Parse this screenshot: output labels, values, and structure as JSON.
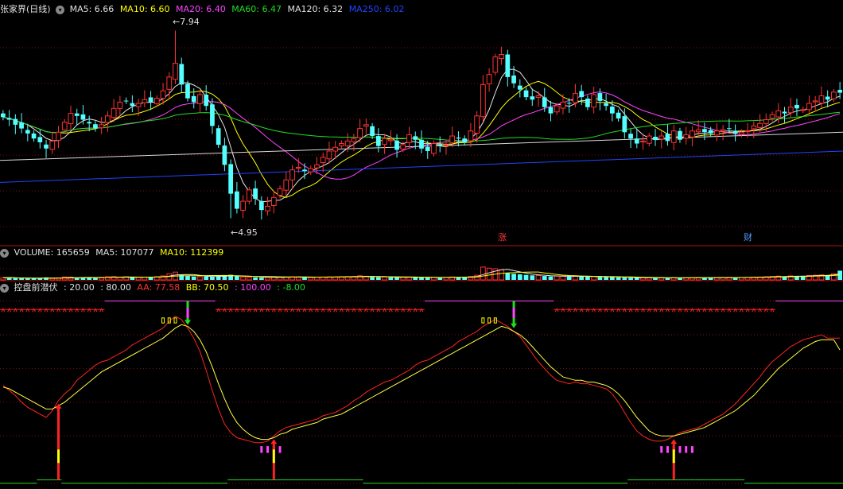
{
  "price_panel": {
    "stock_name": "张家界(日线)",
    "ma_labels": [
      {
        "text": "MA5: 6.66",
        "color": "#e0e0e0"
      },
      {
        "text": "MA10: 6.60",
        "color": "#ffff00"
      },
      {
        "text": "MA20: 6.40",
        "color": "#ff44ff"
      },
      {
        "text": "MA60: 6.47",
        "color": "#22dd22"
      },
      {
        "text": "MA120: 6.32",
        "color": "#e0e0e0"
      },
      {
        "text": "MA250: 6.02",
        "color": "#2244ff"
      }
    ],
    "high_label": "7.94",
    "low_label": "4.95",
    "marker_rise": "涨",
    "marker_fin": "财"
  },
  "volume_panel": {
    "labels": [
      {
        "text": "VOLUME: 165659",
        "color": "#e0e0e0"
      },
      {
        "text": "MA5: 107077",
        "color": "#e0e0e0"
      },
      {
        "text": "MA10: 112399",
        "color": "#ffff00"
      }
    ]
  },
  "indicator_panel": {
    "labels": [
      {
        "text": "控盘前潜伏",
        "color": "#e0e0e0"
      },
      {
        "text": ": 20.00",
        "color": "#e0e0e0"
      },
      {
        "text": ": 80.00",
        "color": "#e0e0e0"
      },
      {
        "text": "AA: 77.58",
        "color": "#ff3333"
      },
      {
        "text": "BB: 70.50",
        "color": "#ffff00"
      },
      {
        "text": ": 100.00",
        "color": "#ff44ff"
      },
      {
        "text": ": -8.00",
        "color": "#22dd22"
      }
    ]
  },
  "chart_data": [
    {
      "type": "candlestick",
      "title": "张家界(日线)",
      "ylim": [
        4.6,
        8.2
      ],
      "x_count": 137,
      "high_annotation": {
        "index": 28,
        "value": 7.94
      },
      "low_annotation": {
        "index": 37,
        "value": 4.95
      },
      "close_series": [
        6.56,
        6.52,
        6.44,
        6.38,
        6.3,
        6.22,
        6.16,
        6.06,
        6.18,
        6.32,
        6.48,
        6.62,
        6.58,
        6.52,
        6.46,
        6.38,
        6.44,
        6.58,
        6.7,
        6.8,
        6.82,
        6.74,
        6.78,
        6.84,
        6.8,
        6.86,
        6.98,
        7.2,
        7.42,
        7.08,
        6.86,
        6.8,
        6.92,
        6.74,
        6.42,
        6.12,
        5.8,
        5.34,
        5.1,
        5.22,
        5.4,
        5.26,
        5.08,
        5.14,
        5.28,
        5.42,
        5.56,
        5.72,
        5.76,
        5.7,
        5.74,
        5.8,
        5.92,
        6.02,
        6.08,
        6.14,
        6.18,
        6.22,
        6.38,
        6.44,
        6.26,
        6.1,
        6.22,
        6.2,
        6.04,
        6.12,
        6.28,
        6.2,
        6.06,
        6.02,
        6.14,
        6.1,
        6.12,
        6.26,
        6.22,
        6.16,
        6.34,
        6.58,
        7.08,
        7.24,
        7.52,
        7.56,
        7.2,
        7.1,
        7.0,
        6.88,
        6.84,
        6.9,
        6.72,
        6.62,
        6.74,
        6.8,
        6.78,
        6.94,
        6.88,
        6.72,
        6.92,
        6.82,
        6.74,
        6.62,
        6.54,
        6.32,
        6.22,
        6.14,
        6.18,
        6.26,
        6.2,
        6.26,
        6.18,
        6.34,
        6.2,
        6.28,
        6.34,
        6.36,
        6.32,
        6.3,
        6.34,
        6.36,
        6.38,
        6.3,
        6.32,
        6.34,
        6.42,
        6.46,
        6.52,
        6.6,
        6.66,
        6.62,
        6.72,
        6.7,
        6.68,
        6.78,
        6.82,
        6.9,
        6.84,
        6.96,
        6.95
      ],
      "moving_averages": [
        {
          "name": "MA5",
          "value": 6.66
        },
        {
          "name": "MA10",
          "value": 6.6
        },
        {
          "name": "MA20",
          "value": 6.4
        },
        {
          "name": "MA60",
          "value": 6.47
        },
        {
          "name": "MA120",
          "value": 6.32
        },
        {
          "name": "MA250",
          "value": 6.02
        }
      ]
    },
    {
      "type": "bar",
      "title": "VOLUME",
      "ylim": [
        0,
        400000
      ],
      "values": [
        40000,
        42000,
        30000,
        28000,
        26000,
        27000,
        30000,
        45000,
        26000,
        32000,
        52000,
        50000,
        42000,
        40000,
        38000,
        42000,
        48000,
        55000,
        60000,
        46000,
        54000,
        45000,
        48000,
        50000,
        56000,
        58000,
        72000,
        110000,
        140000,
        90000,
        70000,
        58000,
        56000,
        62000,
        64000,
        70000,
        76000,
        92000,
        70000,
        52000,
        48000,
        44000,
        40000,
        42000,
        46000,
        50000,
        52000,
        58000,
        55000,
        46000,
        44000,
        48000,
        52000,
        56000,
        54000,
        58000,
        60000,
        62000,
        74000,
        66000,
        52000,
        48000,
        50000,
        44000,
        42000,
        46000,
        50000,
        48000,
        42000,
        40000,
        44000,
        42000,
        46000,
        52000,
        48000,
        52000,
        62000,
        84000,
        230000,
        210000,
        200000,
        180000,
        130000,
        110000,
        100000,
        90000,
        82000,
        78000,
        70000,
        62000,
        68000,
        66000,
        60000,
        64000,
        62000,
        56000,
        60000,
        54000,
        52000,
        50000,
        46000,
        40000,
        38000,
        36000,
        36000,
        38000,
        36000,
        38000,
        34000,
        40000,
        36000,
        38000,
        40000,
        42000,
        40000,
        38000,
        40000,
        44000,
        46000,
        42000,
        44000,
        46000,
        50000,
        52000,
        58000,
        62000,
        68000,
        60000,
        72000,
        70000,
        68000,
        80000,
        84000,
        90000,
        86000,
        110000,
        165659
      ],
      "ma5": 107077,
      "ma10": 112399
    },
    {
      "type": "line",
      "title": "控盘前潜伏",
      "ylim": [
        -10,
        105
      ],
      "reference_levels": [
        20.0,
        80.0,
        100.0,
        -8.0
      ],
      "series": [
        {
          "name": "AA",
          "values": [
            50,
            47,
            44,
            40,
            37,
            35,
            33,
            31,
            35,
            41,
            45,
            48,
            53,
            56,
            59,
            62,
            64,
            65,
            67,
            69,
            71,
            74,
            76,
            78,
            80,
            82,
            84,
            88,
            91,
            89,
            84,
            78,
            70,
            59,
            47,
            36,
            27,
            22,
            19,
            18,
            17,
            16,
            16,
            17,
            20,
            23,
            25,
            26,
            27,
            28,
            29,
            30,
            32,
            33,
            34,
            36,
            38,
            41,
            43,
            46,
            48,
            50,
            52,
            53,
            55,
            57,
            59,
            62,
            64,
            65,
            67,
            69,
            71,
            73,
            76,
            78,
            80,
            82,
            85,
            87,
            89,
            87,
            85,
            82,
            79,
            74,
            69,
            64,
            60,
            56,
            53,
            52,
            51,
            52,
            51,
            51,
            50,
            49,
            48,
            45,
            40,
            34,
            28,
            23,
            20,
            18,
            17,
            17,
            18,
            20,
            22,
            23,
            24,
            25,
            27,
            29,
            31,
            33,
            36,
            39,
            43,
            47,
            51,
            55,
            60,
            64,
            67,
            70,
            73,
            75,
            77,
            78,
            79,
            80,
            78,
            78,
            78
          ]
        },
        {
          "name": "BB",
          "values": [
            49,
            48,
            46,
            44,
            42,
            40,
            38,
            36,
            36,
            38,
            40,
            43,
            46,
            49,
            52,
            55,
            58,
            60,
            62,
            64,
            66,
            68,
            70,
            72,
            74,
            76,
            78,
            81,
            84,
            86,
            85,
            82,
            77,
            70,
            61,
            51,
            42,
            34,
            28,
            24,
            21,
            19,
            18,
            18,
            19,
            21,
            22,
            24,
            25,
            26,
            27,
            28,
            30,
            31,
            32,
            33,
            35,
            37,
            39,
            41,
            43,
            45,
            47,
            49,
            51,
            53,
            55,
            57,
            59,
            61,
            63,
            65,
            67,
            69,
            71,
            73,
            75,
            77,
            79,
            81,
            83,
            85,
            84,
            82,
            80,
            77,
            73,
            69,
            65,
            61,
            58,
            55,
            54,
            53,
            53,
            52,
            52,
            51,
            50,
            48,
            45,
            41,
            36,
            31,
            27,
            23,
            21,
            20,
            20,
            20,
            21,
            22,
            23,
            24,
            25,
            27,
            29,
            31,
            33,
            35,
            38,
            41,
            44,
            48,
            52,
            56,
            60,
            63,
            66,
            69,
            72,
            74,
            76,
            77,
            77,
            77,
            71
          ]
        }
      ]
    }
  ]
}
